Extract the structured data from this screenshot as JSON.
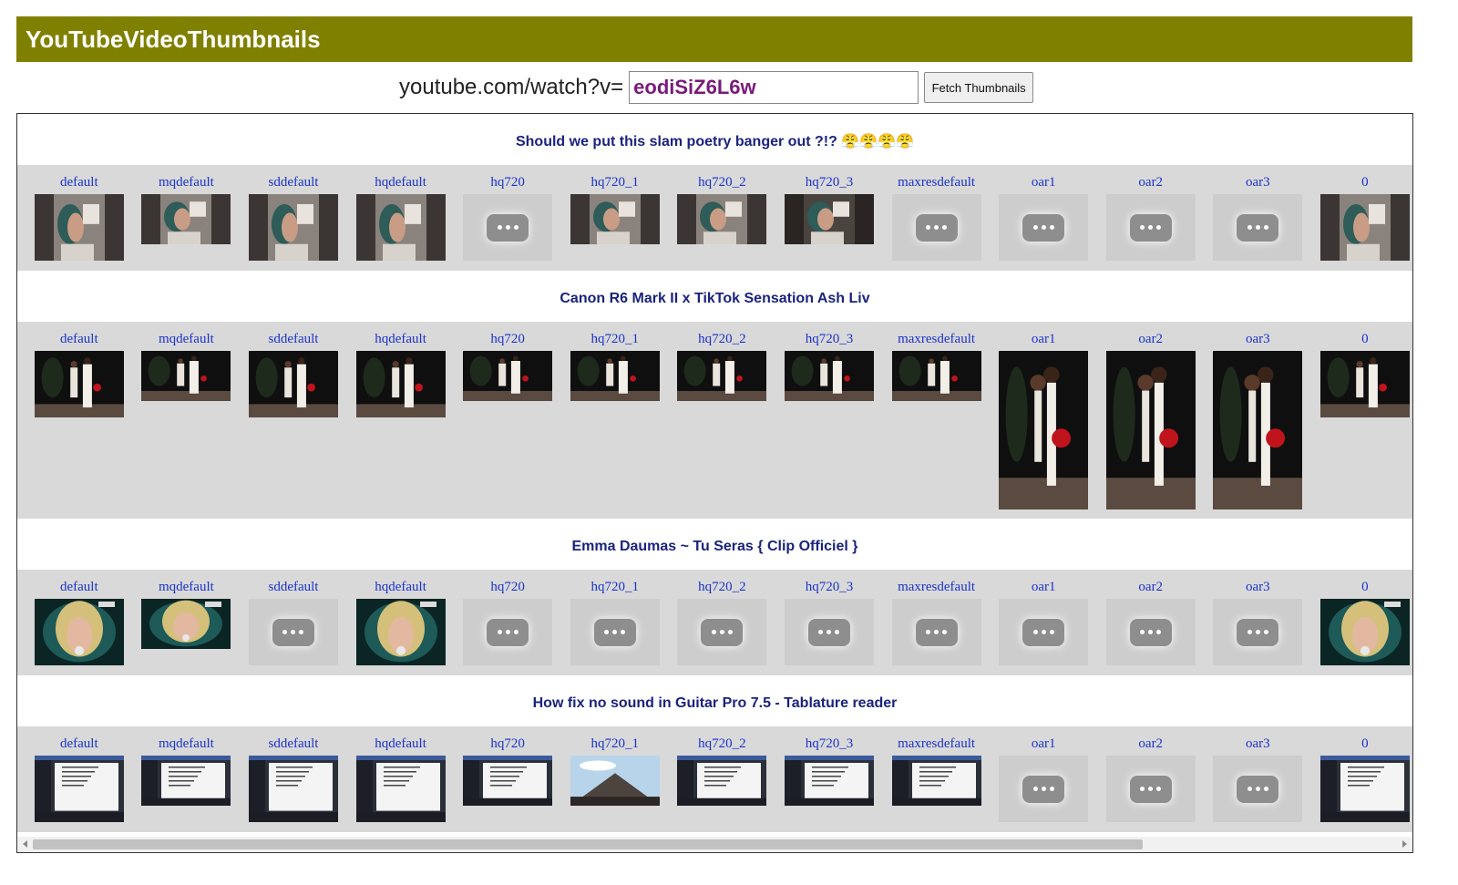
{
  "header": {
    "title": "YouTubeVideoThumbnails"
  },
  "search": {
    "prefix": "youtube.com/watch?v=",
    "value": "eodiSiZ6L6w",
    "button_label": "Fetch Thumbnails"
  },
  "thumbnail_labels": [
    "default",
    "mqdefault",
    "sddefault",
    "hqdefault",
    "hq720",
    "hq720_1",
    "hq720_2",
    "hq720_3",
    "maxresdefault",
    "oar1",
    "oar2",
    "oar3",
    "0"
  ],
  "videos": [
    {
      "title": "Should we put this slam poetry banger out ?!?",
      "emoji": "😤😤😤😤",
      "thumbs": [
        {
          "kind": "image",
          "aspect": "4:3",
          "scene": "portrait-girl"
        },
        {
          "kind": "image",
          "aspect": "16:9",
          "scene": "portrait-girl"
        },
        {
          "kind": "image",
          "aspect": "4:3",
          "scene": "portrait-girl"
        },
        {
          "kind": "image",
          "aspect": "4:3",
          "scene": "portrait-girl"
        },
        {
          "kind": "placeholder"
        },
        {
          "kind": "image",
          "aspect": "16:9",
          "scene": "portrait-girl"
        },
        {
          "kind": "image",
          "aspect": "16:9",
          "scene": "portrait-girl"
        },
        {
          "kind": "image",
          "aspect": "16:9",
          "scene": "portrait-girl-dark"
        },
        {
          "kind": "placeholder"
        },
        {
          "kind": "placeholder"
        },
        {
          "kind": "placeholder"
        },
        {
          "kind": "placeholder"
        },
        {
          "kind": "image",
          "aspect": "4:3",
          "scene": "portrait-girl"
        }
      ]
    },
    {
      "title": "Canon R6 Mark II x TikTok Sensation Ash Liv",
      "emoji": "",
      "thumbs": [
        {
          "kind": "image",
          "aspect": "4:3",
          "scene": "couple-night"
        },
        {
          "kind": "image",
          "aspect": "16:9",
          "scene": "couple-night"
        },
        {
          "kind": "image",
          "aspect": "4:3",
          "scene": "couple-night"
        },
        {
          "kind": "image",
          "aspect": "4:3",
          "scene": "couple-night"
        },
        {
          "kind": "image",
          "aspect": "16:9",
          "scene": "couple-night"
        },
        {
          "kind": "image",
          "aspect": "16:9",
          "scene": "couple-night"
        },
        {
          "kind": "image",
          "aspect": "16:9",
          "scene": "couple-night"
        },
        {
          "kind": "image",
          "aspect": "16:9",
          "scene": "couple-night"
        },
        {
          "kind": "image",
          "aspect": "16:9",
          "scene": "couple-night"
        },
        {
          "kind": "image",
          "aspect": "9:16",
          "scene": "couple-night"
        },
        {
          "kind": "image",
          "aspect": "9:16",
          "scene": "couple-night"
        },
        {
          "kind": "image",
          "aspect": "9:16",
          "scene": "couple-night"
        },
        {
          "kind": "image",
          "aspect": "4:3",
          "scene": "couple-night"
        }
      ]
    },
    {
      "title": "Emma Daumas ~ Tu Seras { Clip Officiel }",
      "emoji": "",
      "thumbs": [
        {
          "kind": "image",
          "aspect": "4:3",
          "scene": "singer"
        },
        {
          "kind": "image",
          "aspect": "16:9",
          "scene": "singer"
        },
        {
          "kind": "placeholder"
        },
        {
          "kind": "image",
          "aspect": "4:3",
          "scene": "singer"
        },
        {
          "kind": "placeholder"
        },
        {
          "kind": "placeholder"
        },
        {
          "kind": "placeholder"
        },
        {
          "kind": "placeholder"
        },
        {
          "kind": "placeholder"
        },
        {
          "kind": "placeholder"
        },
        {
          "kind": "placeholder"
        },
        {
          "kind": "placeholder"
        },
        {
          "kind": "image",
          "aspect": "4:3",
          "scene": "singer"
        }
      ]
    },
    {
      "title": "How fix no sound in Guitar Pro 7.5 - Tablature reader",
      "emoji": "",
      "thumbs": [
        {
          "kind": "image",
          "aspect": "4:3",
          "scene": "screen"
        },
        {
          "kind": "image",
          "aspect": "16:9",
          "scene": "screen"
        },
        {
          "kind": "image",
          "aspect": "4:3",
          "scene": "screen"
        },
        {
          "kind": "image",
          "aspect": "4:3",
          "scene": "screen"
        },
        {
          "kind": "image",
          "aspect": "16:9",
          "scene": "screen"
        },
        {
          "kind": "image",
          "aspect": "16:9",
          "scene": "mountain"
        },
        {
          "kind": "image",
          "aspect": "16:9",
          "scene": "screen"
        },
        {
          "kind": "image",
          "aspect": "16:9",
          "scene": "screen"
        },
        {
          "kind": "image",
          "aspect": "16:9",
          "scene": "screen"
        },
        {
          "kind": "placeholder"
        },
        {
          "kind": "placeholder"
        },
        {
          "kind": "placeholder"
        },
        {
          "kind": "image",
          "aspect": "4:3",
          "scene": "screen"
        }
      ]
    }
  ]
}
